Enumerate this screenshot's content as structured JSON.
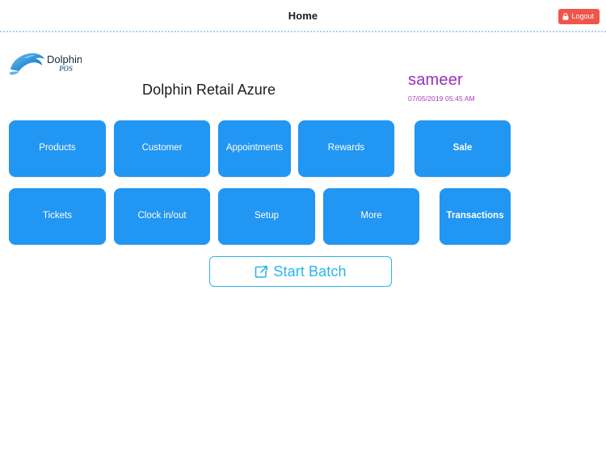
{
  "header": {
    "title": "Home",
    "logout_label": "Logout",
    "lock_icon": "lock-icon"
  },
  "brand": {
    "logo_name": "Dolphin",
    "logo_sub": "POS",
    "logo_icon": "dolphin-logo-icon"
  },
  "page": {
    "title": "Dolphin Retail Azure"
  },
  "user": {
    "name": "sameer",
    "datetime": "07/05/2019 05:45 AM"
  },
  "tiles": {
    "row1": [
      {
        "label": "Products",
        "bold": false
      },
      {
        "label": "Customer",
        "bold": false
      },
      {
        "label": "Appointments",
        "bold": false
      },
      {
        "label": "Rewards",
        "bold": false
      },
      {
        "label": "Sale",
        "bold": true
      }
    ],
    "row2": [
      {
        "label": "Tickets",
        "bold": false
      },
      {
        "label": "Clock in/out",
        "bold": false
      },
      {
        "label": "Setup",
        "bold": false
      },
      {
        "label": "More",
        "bold": false
      },
      {
        "label": "Transactions",
        "bold": true
      }
    ]
  },
  "start_batch": {
    "label": "Start Batch",
    "icon": "external-link-icon"
  },
  "colors": {
    "tile_blue": "#2196f3",
    "logout_red": "#f0554a",
    "user_purple": "#9b30b8",
    "datetime_purple": "#a93bb8",
    "accent_cyan": "#29b6e8",
    "divider_blue": "#a8d3f0"
  }
}
